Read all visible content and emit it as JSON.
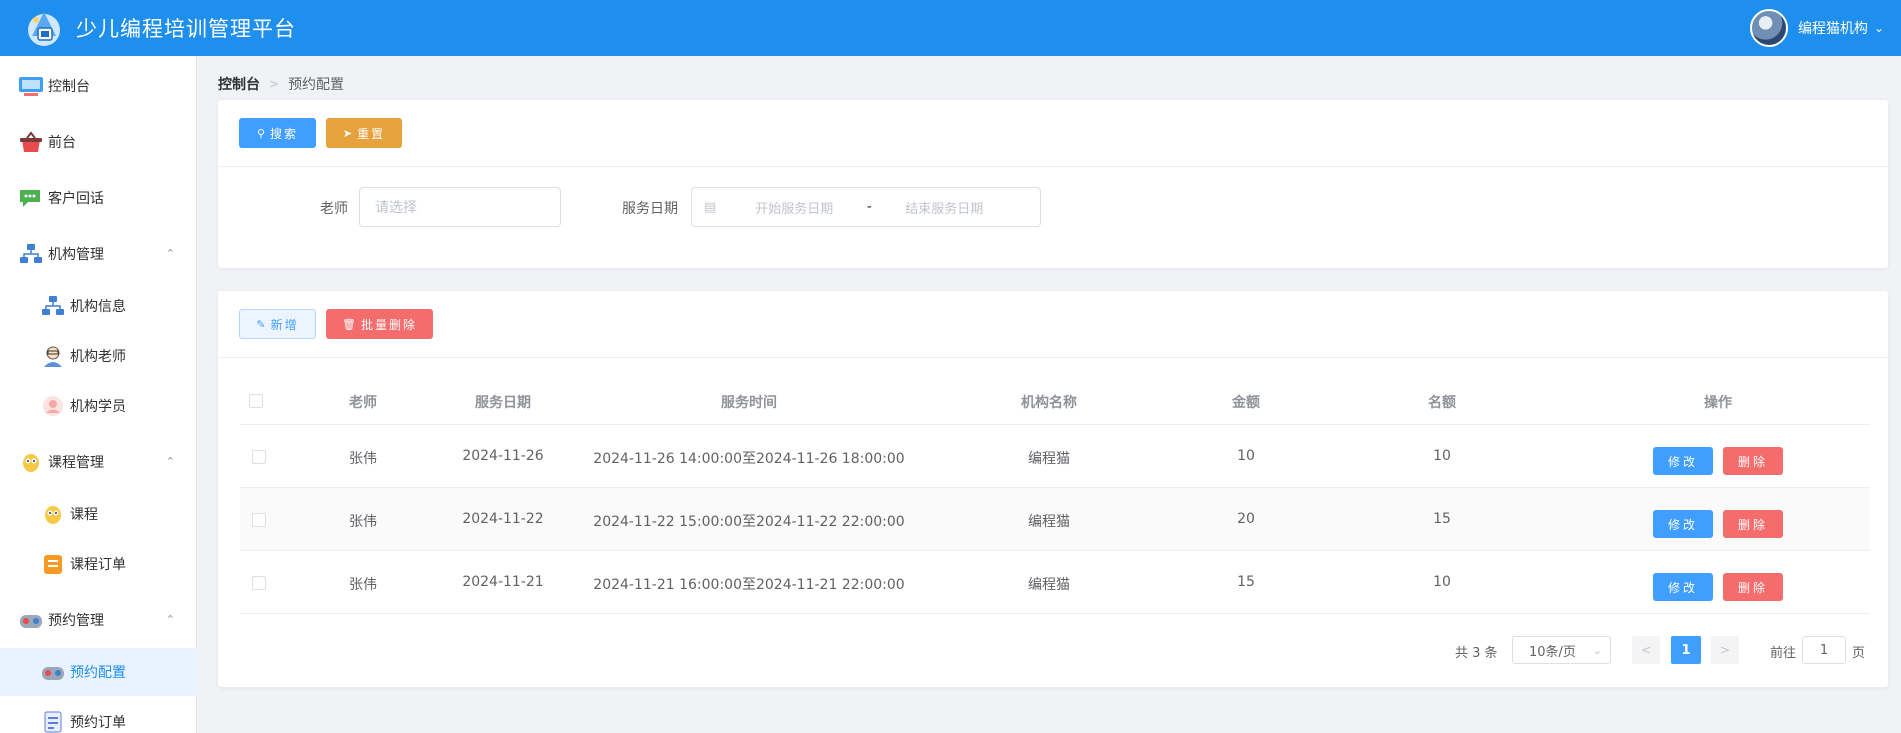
{
  "header": {
    "title": "少儿编程培训管理平台",
    "user_name": "编程猫机构",
    "brand_color": "#1e8fec"
  },
  "sidebar": {
    "items": [
      {
        "label": "控制台",
        "icon": "monitor-icon"
      },
      {
        "label": "前台",
        "icon": "basket-icon"
      },
      {
        "label": "客户回话",
        "icon": "chat-icon"
      },
      {
        "label": "机构管理",
        "icon": "org-chart-icon",
        "expanded": true
      },
      {
        "label": "机构信息",
        "icon": "org-chart-icon"
      },
      {
        "label": "机构老师",
        "icon": "teacher-icon"
      },
      {
        "label": "机构学员",
        "icon": "student-icon"
      },
      {
        "label": "课程管理",
        "icon": "mascot-icon",
        "expanded": true
      },
      {
        "label": "课程",
        "icon": "mascot-icon"
      },
      {
        "label": "课程订单",
        "icon": "order-icon"
      },
      {
        "label": "预约管理",
        "icon": "gamepad-icon",
        "expanded": true
      },
      {
        "label": "预约配置",
        "icon": "gamepad-icon",
        "active": true
      },
      {
        "label": "预约订单",
        "icon": "list-doc-icon"
      }
    ]
  },
  "breadcrumb": {
    "home": "控制台",
    "current": "预约配置"
  },
  "search": {
    "search_btn": "搜索",
    "reset_btn": "重置",
    "teacher_label": "老师",
    "teacher_placeholder": "请选择",
    "date_label": "服务日期",
    "start_placeholder": "开始服务日期",
    "range_sep": "-",
    "end_placeholder": "结束服务日期"
  },
  "toolbar": {
    "add_btn": "新增",
    "batch_delete_btn": "批量删除"
  },
  "table": {
    "columns": [
      "老师",
      "服务日期",
      "服务时间",
      "机构名称",
      "金额",
      "名额",
      "操作"
    ],
    "rows": [
      {
        "teacher": "张伟",
        "date": "2024-11-26",
        "time": "2024-11-26 14:00:00至2024-11-26 18:00:00",
        "org": "编程猫",
        "amount": "10",
        "quota": "10"
      },
      {
        "teacher": "张伟",
        "date": "2024-11-22",
        "time": "2024-11-22 15:00:00至2024-11-22 22:00:00",
        "org": "编程猫",
        "amount": "20",
        "quota": "15"
      },
      {
        "teacher": "张伟",
        "date": "2024-11-21",
        "time": "2024-11-21 16:00:00至2024-11-21 22:00:00",
        "org": "编程猫",
        "amount": "15",
        "quota": "10"
      }
    ],
    "edit_btn": "修改",
    "delete_btn": "删除"
  },
  "pager": {
    "total": "共 3 条",
    "page_size": "10条/页",
    "current_page": "1",
    "goto_label": "前往",
    "goto_value": "1",
    "page_unit": "页"
  }
}
